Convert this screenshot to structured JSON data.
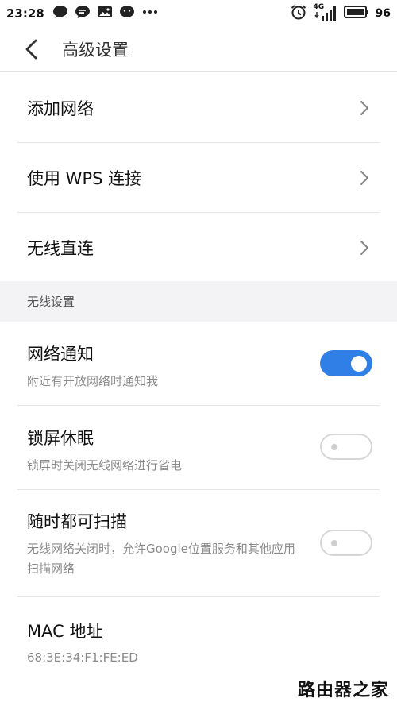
{
  "status_bar": {
    "time": "23:28",
    "icons_left": [
      "chat-bubble-icon",
      "message-icon",
      "gallery-icon",
      "wechat-icon",
      "more-dots-icon"
    ],
    "network": "4G",
    "battery": "96"
  },
  "header": {
    "title": "高级设置"
  },
  "menu": {
    "items": [
      {
        "label": "添加网络"
      },
      {
        "label": "使用 WPS 连接"
      },
      {
        "label": "无线直连"
      }
    ]
  },
  "wireless_section": {
    "header": "无线设置",
    "toggles": [
      {
        "title": "网络通知",
        "subtitle": "附近有开放网络时通知我",
        "enabled": true
      },
      {
        "title": "锁屏休眠",
        "subtitle": "锁屏时关闭无线网络进行省电",
        "enabled": false
      },
      {
        "title": "随时都可扫描",
        "subtitle": "无线网络关闭时，允许Google位置服务和其他应用扫描网络",
        "enabled": false
      }
    ]
  },
  "mac": {
    "title": "MAC 地址",
    "value": "68:3E:34:F1:FE:ED"
  },
  "watermark": "路由器之家",
  "colors": {
    "accent": "#2f7fe6",
    "section_bg": "#f3f3f5",
    "subtitle": "#8a8a8a"
  }
}
